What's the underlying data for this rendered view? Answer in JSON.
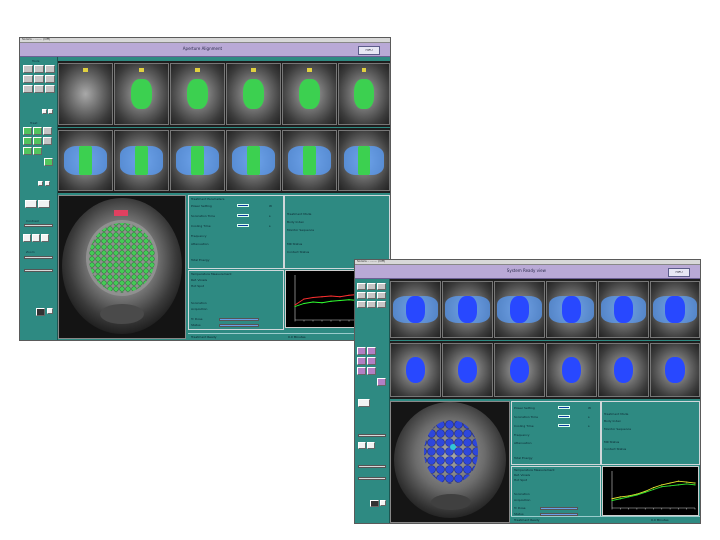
{
  "window1": {
    "title_bar": "Sonics - ........ (Off)",
    "menu_caption": "Aperture  Alignment",
    "menu_tag": "HIFU",
    "left_panel": {
      "section_labels": [
        "Tools",
        "Treat",
        "Contrast",
        "Zoom"
      ],
      "level_value_1": "",
      "level_value_2": ""
    },
    "params": {
      "section_title": "Treatment Parameters",
      "rows": [
        {
          "label": "Power Setting",
          "value": "",
          "unit": "W"
        },
        {
          "label": "Sonication Time",
          "value": "",
          "unit": "s"
        },
        {
          "label": "Cooling Time",
          "value": "",
          "unit": "s"
        },
        {
          "label": "Frequency",
          "value": "",
          "unit": ""
        },
        {
          "label": "Attenuation",
          "value": "",
          "unit": ""
        },
        {
          "label": "Total Energy",
          "value": "",
          "unit": ""
        }
      ],
      "right_rows": [
        {
          "label": "Treatment Mode",
          "value": ""
        },
        {
          "label": "Body Index",
          "value": ""
        },
        {
          "label": "Monitor Sequence",
          "value": ""
        },
        {
          "label": "MR Status",
          "value": ""
        },
        {
          "label": "Contact Status",
          "value": ""
        }
      ],
      "temp_section_title": "Temperature Measurement",
      "temp_rows": [
        {
          "label": "Ref. Voxels",
          "value": ""
        },
        {
          "label": "Hot Spot",
          "value": ""
        }
      ],
      "bottom_rows": [
        {
          "label": "Sonication",
          "value": ""
        },
        {
          "label": "Acquisition",
          "value": ""
        },
        {
          "label": "Tc Dose",
          "value": ""
        },
        {
          "label": "Status",
          "value": ""
        }
      ],
      "status_left": "Treatment  Ready",
      "status_right": "0.0  Minutes"
    },
    "chart_data": {
      "type": "line",
      "title": "",
      "xlabel": "",
      "ylabel": "",
      "x": [
        0,
        1,
        2,
        3,
        4,
        5,
        6,
        7,
        8,
        9,
        10
      ],
      "series": [
        {
          "color": "#ff3030",
          "values": [
            20,
            28,
            30,
            31,
            32,
            31,
            33,
            34,
            33,
            36,
            38
          ]
        },
        {
          "color": "#30ff30",
          "values": [
            18,
            22,
            24,
            23,
            25,
            26,
            27,
            26,
            28,
            30,
            32
          ]
        }
      ],
      "ylim": [
        0,
        60
      ]
    }
  },
  "window2": {
    "title_bar": "Sonics - ........ (Off)",
    "menu_caption": "System  Ready  view",
    "menu_tag": "HIFU",
    "params": {
      "rows": [
        {
          "label": "Power Setting",
          "value": "",
          "unit": "W"
        },
        {
          "label": "Sonication Time",
          "value": "",
          "unit": "s"
        },
        {
          "label": "Cooling Time",
          "value": "",
          "unit": "s"
        },
        {
          "label": "Frequency",
          "value": "",
          "unit": ""
        },
        {
          "label": "Attenuation",
          "value": "",
          "unit": ""
        },
        {
          "label": "Total Energy",
          "value": "",
          "unit": ""
        }
      ],
      "right_rows": [
        {
          "label": "Treatment Mode",
          "value": ""
        },
        {
          "label": "Body Index",
          "value": ""
        },
        {
          "label": "Monitor Sequence",
          "value": ""
        },
        {
          "label": "MR Status",
          "value": ""
        },
        {
          "label": "Contact Status",
          "value": ""
        }
      ],
      "temp_section_title": "Temperature Measurement",
      "temp_rows": [
        {
          "label": "Ref. Voxels",
          "value": ""
        },
        {
          "label": "Hot Spot",
          "value": ""
        }
      ],
      "bottom_rows": [
        {
          "label": "Sonication",
          "value": ""
        },
        {
          "label": "Acquisition",
          "value": ""
        },
        {
          "label": "Tc Dose",
          "value": ""
        },
        {
          "label": "Status",
          "value": ""
        }
      ],
      "status_left": "Treatment  Ready",
      "status_right": "0.0  Minutes"
    },
    "chart_data": {
      "type": "line",
      "title": "",
      "xlabel": "",
      "ylabel": "",
      "x": [
        0,
        1,
        2,
        3,
        4,
        5,
        6,
        7,
        8,
        9,
        10
      ],
      "series": [
        {
          "color": "#e6e630",
          "values": [
            10,
            12,
            13,
            15,
            18,
            22,
            25,
            27,
            29,
            28,
            27
          ]
        },
        {
          "color": "#30e630",
          "values": [
            8,
            10,
            12,
            14,
            17,
            20,
            23,
            24,
            25,
            26,
            25
          ]
        }
      ],
      "ylim": [
        0,
        40
      ]
    }
  },
  "colors": {
    "panel": "#2e8a82",
    "menubar": "#b9a9d6",
    "overlay_green": "#3cd050",
    "overlay_blue": "#2848ff",
    "beam_blue": "#5aa0ff"
  }
}
